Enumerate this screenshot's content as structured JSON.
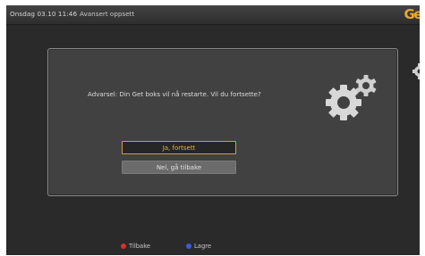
{
  "header": {
    "datetime": "Onsdag 03.10 11:46",
    "title": "Avansert oppsett",
    "logo_text": "Ge"
  },
  "dialog": {
    "message": "Advarsel: Din Get boks vil nå restarte. Vil du fortsette?",
    "confirm_label": "Ja, fortsett",
    "cancel_label": "Nei, gå tilbake",
    "icon": "gears-icon"
  },
  "footer": {
    "back": {
      "label": "Tilbake",
      "color": "#d9302a"
    },
    "save": {
      "label": "Lagre",
      "color": "#3d5bd6"
    }
  },
  "colors": {
    "accent": "#e5b53b",
    "background": "#2a2a2a",
    "dialog": "#414141"
  }
}
